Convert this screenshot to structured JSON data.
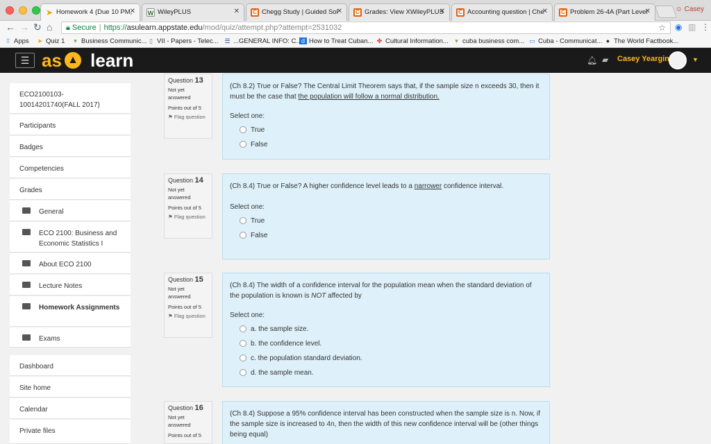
{
  "browser": {
    "tabs": [
      {
        "title": "Homework 4 (Due 10 PM,",
        "icon": "arrow-icon"
      },
      {
        "title": "WileyPLUS",
        "icon": "w-icon"
      },
      {
        "title": "Chegg Study | Guided Sol",
        "icon": "c-icon"
      },
      {
        "title": "Grades: View XWileyPLUS",
        "icon": "c-icon"
      },
      {
        "title": "Accounting question | Che",
        "icon": "c-icon"
      },
      {
        "title": "Problem 26-4A (Part Level",
        "icon": "c-icon"
      }
    ],
    "profile": "Casey",
    "address": {
      "secure": "Secure",
      "protocol": "https://",
      "host": "asulearn.appstate.edu",
      "path": "/mod/quiz/attempt.php?attempt=2531032"
    },
    "bookmarks": [
      "Apps",
      "Quiz 1",
      "Business Communic...",
      "VII - Papers - Telec...",
      "...GENERAL INFO: C...",
      "How to Treat Cuban...",
      "Cultural Information...",
      "cuba business com...",
      "Cuba - Communicat...",
      "The World Factbook..."
    ]
  },
  "header": {
    "logo_as": "as",
    "logo_learn": "learn",
    "user": "Casey Yeargin"
  },
  "sidebar": {
    "items": [
      {
        "label": "ECO2100103-10014201740(FALL 2017)"
      },
      {
        "label": "Participants"
      },
      {
        "label": "Badges"
      },
      {
        "label": "Competencies"
      },
      {
        "label": "Grades"
      },
      {
        "label": "General"
      },
      {
        "label": "ECO 2100: Business and Economic Statistics I"
      },
      {
        "label": "About ECO 2100"
      },
      {
        "label": "Lecture Notes"
      },
      {
        "label": "Homework Assignments"
      },
      {
        "label": "Exams"
      },
      {
        "label": "Dashboard"
      },
      {
        "label": "Site home"
      },
      {
        "label": "Calendar"
      },
      {
        "label": "Private files"
      }
    ]
  },
  "questions": [
    {
      "label": "Question",
      "number": "13",
      "status": "Not yet answered",
      "points": "Points out of 5",
      "flag": "Flag question",
      "text_pre": "(Ch 8.2) True or False? The Central Limit Theorem says that, if the sample size n exceeds 30, then it must be the case that ",
      "text_u": "the population will follow a normal distribution.",
      "text_post": "",
      "select": "Select one:",
      "options": [
        "True",
        "False"
      ]
    },
    {
      "label": "Question",
      "number": "14",
      "status": "Not yet answered",
      "points": "Points out of 5",
      "flag": "Flag question",
      "text_pre": "(Ch 8.4) True or False? A higher confidence level leads to a ",
      "text_u": "narrower",
      "text_post": " confidence interval.",
      "select": "Select one:",
      "options": [
        "True",
        "False"
      ]
    },
    {
      "label": "Question",
      "number": "15",
      "status": "Not yet answered",
      "points": "Points out of 5",
      "flag": "Flag question",
      "text_pre": "(Ch 8.4) The width of a confidence interval for the population mean when the standard deviation of the population is known is ",
      "text_i": "NOT",
      "text_post": " affected by",
      "select": "Select one:",
      "options": [
        "a. the sample size.",
        "b. the confidence level.",
        "c. the population standard deviation.",
        "d. the sample mean."
      ]
    },
    {
      "label": "Question",
      "number": "16",
      "status": "Not yet answered",
      "points": "Points out of 5",
      "text_pre": "(Ch 8.4) Suppose a 95% confidence interval has been constructed when the sample size is n. Now, if the sample size is increased to 4n, then the width of this new confidence interval will be (other things being equal)"
    }
  ]
}
